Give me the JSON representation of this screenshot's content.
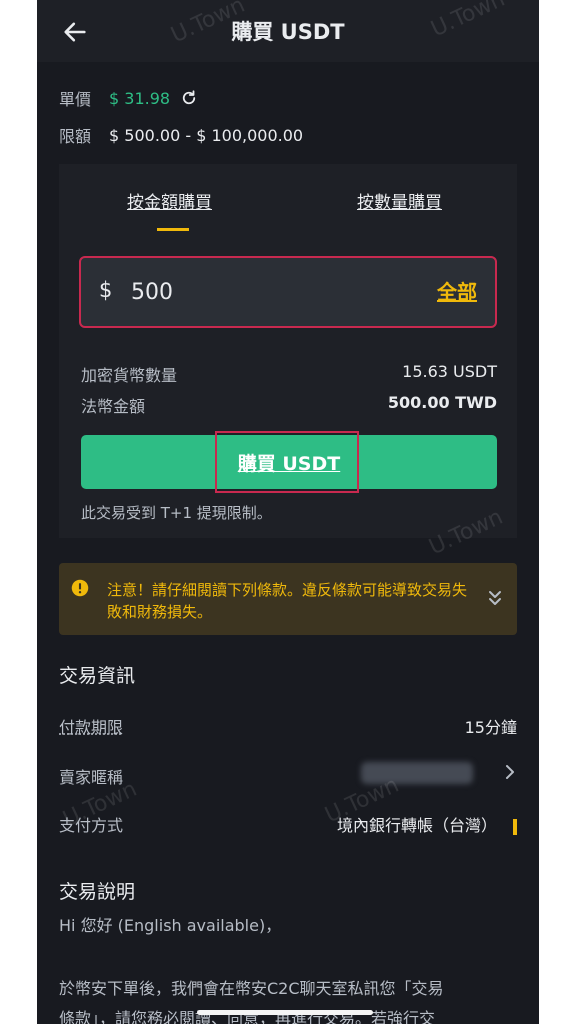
{
  "header": {
    "title": "購買 USDT"
  },
  "watermark": "U.Town",
  "info": {
    "price_label": "單價",
    "price_value": "$ 31.98",
    "limit_label": "限額",
    "limit_value": "$ 500.00 - $ 100,000.00"
  },
  "tabs": [
    {
      "label": "按金額購買",
      "active": true
    },
    {
      "label": "按數量購買",
      "active": false
    }
  ],
  "amount": {
    "currency": "$",
    "value": "500",
    "all_label": "全部"
  },
  "summary": {
    "crypto_label": "加密貨幣數量",
    "crypto_value": "15.63 USDT",
    "fiat_label": "法幣金額",
    "fiat_value": "500.00 TWD"
  },
  "buy_button": "購買 USDT",
  "note": "此交易受到 T+1 提現限制。",
  "warning": "注意！請仔細閱讀下列條款。違反條款可能導致交易失敗和財務損失。",
  "trade_info": {
    "title": "交易資訊",
    "payment_period_label": "付款期限",
    "payment_period_value": "15分鐘",
    "seller_label": "賣家暱稱",
    "payment_method_label": "支付方式",
    "payment_method_value": "境內銀行轉帳（台灣）"
  },
  "description": {
    "title": "交易說明",
    "line1": "Hi 您好 (English available)，",
    "line2": "於幣安下單後，我們會在幣安C2C聊天室私訊您「交易",
    "line3": "條款」，請您務必閱讀、同意，再進行交易。若強行交"
  },
  "colors": {
    "accent": "#f0b90b",
    "buy": "#2ebd85",
    "highlight": "#c8294f",
    "background": "#181a20"
  }
}
